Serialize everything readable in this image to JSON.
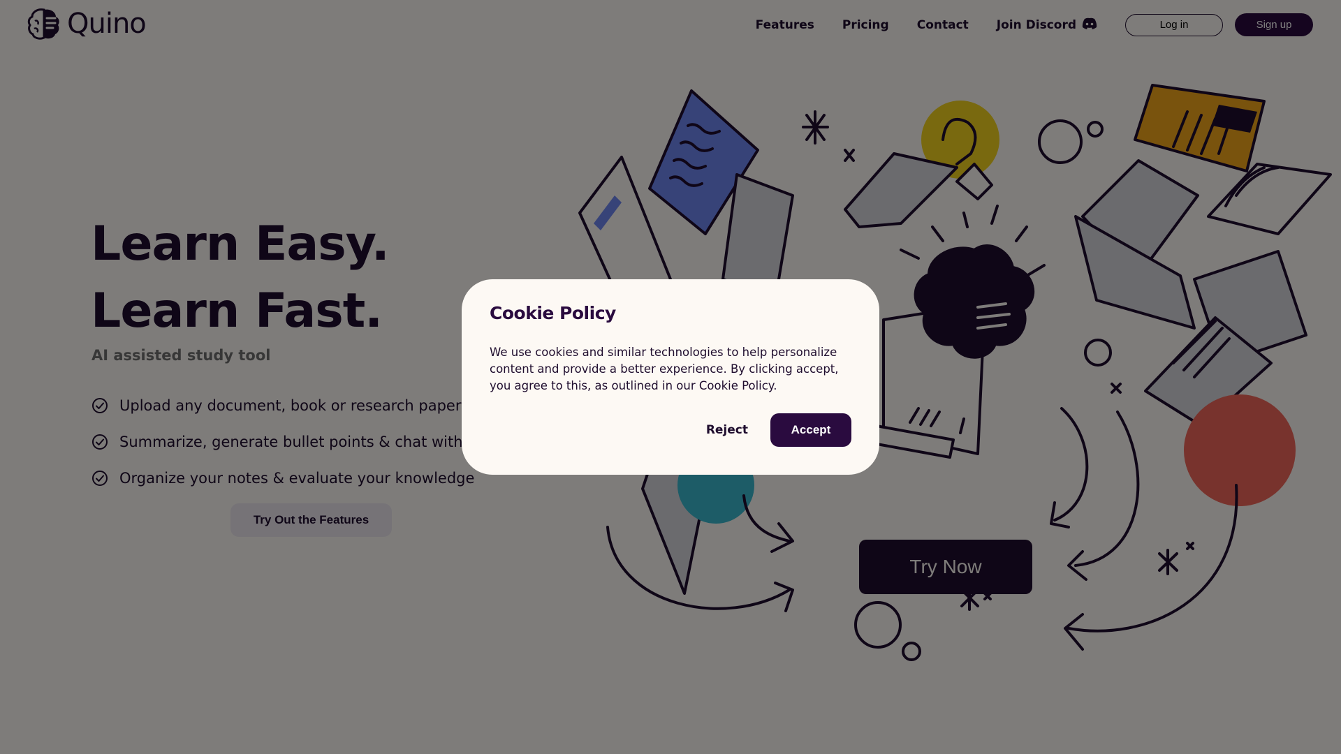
{
  "brand": {
    "name": "Quino"
  },
  "nav": {
    "features": "Features",
    "pricing": "Pricing",
    "contact": "Contact",
    "discord": "Join Discord",
    "login": "Log in",
    "signup": "Sign up"
  },
  "hero": {
    "title_line1": "Learn Easy.",
    "title_line2": "Learn Fast.",
    "subtitle": "AI assisted study tool",
    "features": [
      "Upload any document, book or research paper",
      "Summarize, generate bullet points & chat with your",
      "Organize your notes & evaluate your knowledge"
    ],
    "cta_features": "Try Out the Features",
    "cta_try_now": "Try Now"
  },
  "cookie_modal": {
    "title": "Cookie Policy",
    "body": "We use cookies and similar technologies to help personalize content and provide a better experience. By clicking accept, you agree to this, as outlined in our Cookie Policy.",
    "reject": "Reject",
    "accept": "Accept"
  },
  "colors": {
    "primary": "#2a0b3f",
    "ink": "#1f0d2e",
    "background": "#fdf9f4",
    "muted_text": "#6e6e6e",
    "accent_blue": "#6f86f0",
    "accent_yellow": "#f2d21f",
    "accent_orange": "#f2a61a",
    "accent_teal": "#3bb9cf",
    "accent_red": "#f0675a"
  }
}
